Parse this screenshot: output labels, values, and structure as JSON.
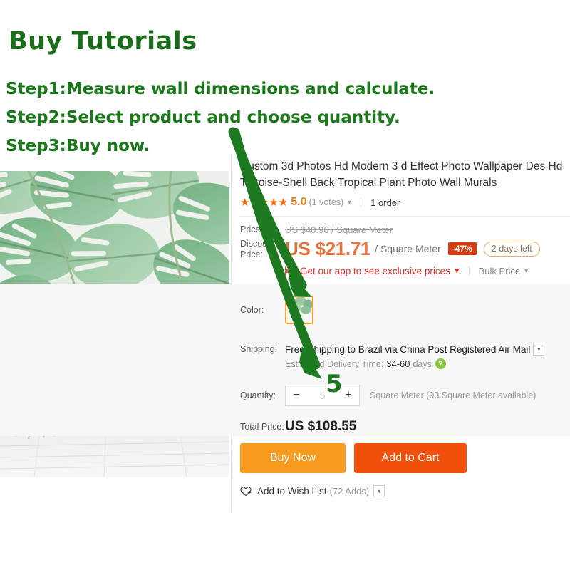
{
  "tutorial": {
    "title": "Buy Tutorials",
    "steps": [
      "Step1:Measure wall dimensions and calculate.",
      "Step2:Select product and choose quantity.",
      "Step3:Buy now."
    ],
    "accent_color": "#1a7a1a",
    "annotation_quantity": "5"
  },
  "product": {
    "title": "Custom 3d Photos Hd Modern 3 d Effect Photo Wallpaper Des Hd Tortoise-Shell Back Tropical Plant Photo Wall Murals",
    "rating": {
      "stars": "★★★★★",
      "score": "5.0",
      "votes": "(1 votes)",
      "caret": "▾",
      "orders": "1 order"
    },
    "price": {
      "label": "Price:",
      "original": "US $40.96 / Square Meter",
      "discount_label": "Discount Price:",
      "amount": "US $21.71",
      "unit": "/ Square Meter",
      "discount_badge": "-47%",
      "days_left": "2 days left",
      "amount_color": "#e8703a",
      "badge_color": "#d63c10"
    },
    "app_promo": {
      "text": "Get our app to see exclusive prices",
      "caret": "▾",
      "bulk": "Bulk Price",
      "bulk_caret": "▾",
      "color": "#e02e24"
    },
    "color_option": {
      "label": "Color:",
      "swatch_name": "tropical-plant-mural-swatch"
    },
    "shipping": {
      "label": "Shipping:",
      "method": "Free Shipping to Brazil via China Post Registered Air Mail",
      "caret": "▾",
      "eta_label": "Estimated Delivery Time:",
      "eta_value": "34-60",
      "eta_unit": "days",
      "help": "?"
    },
    "quantity": {
      "label": "Quantity:",
      "minus": "−",
      "value": "5",
      "plus": "+",
      "unit": "Square Meter (93 Square Meter available)"
    },
    "total": {
      "label": "Total Price:",
      "value": "US $108.55"
    },
    "actions": {
      "buy_now": "Buy Now",
      "add_to_cart": "Add to Cart",
      "buy_color": "#f79a1e",
      "cart_color": "#f0500c"
    },
    "wishlist": {
      "label": "Add to Wish List",
      "count": "(72 Adds)",
      "caret": "▾"
    }
  }
}
